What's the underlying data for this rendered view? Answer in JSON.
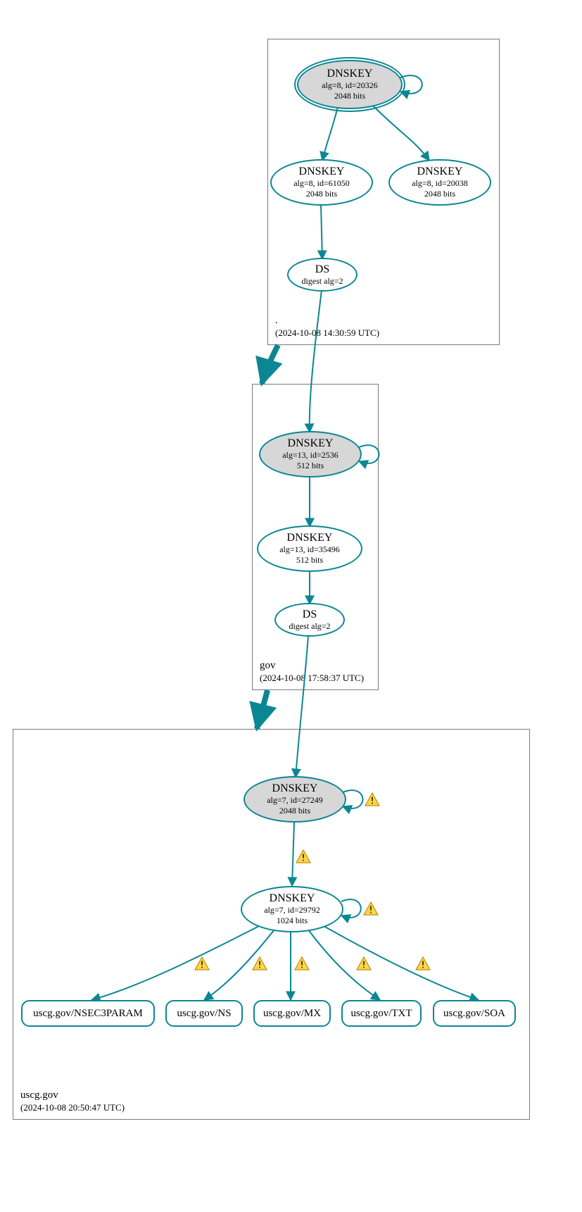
{
  "colors": {
    "teal": "#0b8793",
    "node_fill_grey": "#d7d7d7",
    "box_border": "#7a7a7a"
  },
  "zones": {
    "root": {
      "name": ".",
      "timestamp": "(2024-10-08 14:30:59 UTC)"
    },
    "gov": {
      "name": "gov",
      "timestamp": "(2024-10-08 17:58:37 UTC)"
    },
    "uscg": {
      "name": "uscg.gov",
      "timestamp": "(2024-10-08 20:50:47 UTC)"
    }
  },
  "nodes": {
    "root_ksk": {
      "title": "DNSKEY",
      "line2": "alg=8, id=20326",
      "line3": "2048 bits"
    },
    "root_zsk": {
      "title": "DNSKEY",
      "line2": "alg=8, id=61050",
      "line3": "2048 bits"
    },
    "root_dnskey3": {
      "title": "DNSKEY",
      "line2": "alg=8, id=20038",
      "line3": "2048 bits"
    },
    "root_ds": {
      "title": "DS",
      "line2": "digest alg=2"
    },
    "gov_ksk": {
      "title": "DNSKEY",
      "line2": "alg=13, id=2536",
      "line3": "512 bits"
    },
    "gov_zsk": {
      "title": "DNSKEY",
      "line2": "alg=13, id=35496",
      "line3": "512 bits"
    },
    "gov_ds": {
      "title": "DS",
      "line2": "digest alg=2"
    },
    "uscg_ksk": {
      "title": "DNSKEY",
      "line2": "alg=7, id=27249",
      "line3": "2048 bits"
    },
    "uscg_zsk": {
      "title": "DNSKEY",
      "line2": "alg=7, id=29792",
      "line3": "1024 bits"
    }
  },
  "rrsets": {
    "nsec3param": "uscg.gov/NSEC3PARAM",
    "ns": "uscg.gov/NS",
    "mx": "uscg.gov/MX",
    "txt": "uscg.gov/TXT",
    "soa": "uscg.gov/SOA"
  },
  "chart_data": {
    "type": "graph",
    "description": "DNSSEC authentication chain (DNSViz-style) for uscg.gov",
    "zones": [
      {
        "name": ".",
        "timestamp_utc": "2024-10-08 14:30:59"
      },
      {
        "name": "gov",
        "timestamp_utc": "2024-10-08 17:58:37"
      },
      {
        "name": "uscg.gov",
        "timestamp_utc": "2024-10-08 20:50:47"
      }
    ],
    "records": [
      {
        "id": "root_ksk",
        "zone": ".",
        "type": "DNSKEY",
        "alg": 8,
        "key_id": 20326,
        "bits": 2048,
        "role": "KSK/trust-anchor"
      },
      {
        "id": "root_zsk",
        "zone": ".",
        "type": "DNSKEY",
        "alg": 8,
        "key_id": 61050,
        "bits": 2048,
        "role": "ZSK"
      },
      {
        "id": "root_k3",
        "zone": ".",
        "type": "DNSKEY",
        "alg": 8,
        "key_id": 20038,
        "bits": 2048
      },
      {
        "id": "root_ds",
        "zone": ".",
        "type": "DS",
        "digest_alg": 2
      },
      {
        "id": "gov_ksk",
        "zone": "gov",
        "type": "DNSKEY",
        "alg": 13,
        "key_id": 2536,
        "bits": 512,
        "role": "KSK"
      },
      {
        "id": "gov_zsk",
        "zone": "gov",
        "type": "DNSKEY",
        "alg": 13,
        "key_id": 35496,
        "bits": 512,
        "role": "ZSK"
      },
      {
        "id": "gov_ds",
        "zone": "gov",
        "type": "DS",
        "digest_alg": 2
      },
      {
        "id": "uscg_ksk",
        "zone": "uscg.gov",
        "type": "DNSKEY",
        "alg": 7,
        "key_id": 27249,
        "bits": 2048,
        "role": "KSK",
        "status": "warning"
      },
      {
        "id": "uscg_zsk",
        "zone": "uscg.gov",
        "type": "DNSKEY",
        "alg": 7,
        "key_id": 29792,
        "bits": 1024,
        "role": "ZSK",
        "status": "warning"
      },
      {
        "id": "rr_nsec3",
        "zone": "uscg.gov",
        "type": "RRset",
        "name": "uscg.gov/NSEC3PARAM"
      },
      {
        "id": "rr_ns",
        "zone": "uscg.gov",
        "type": "RRset",
        "name": "uscg.gov/NS"
      },
      {
        "id": "rr_mx",
        "zone": "uscg.gov",
        "type": "RRset",
        "name": "uscg.gov/MX"
      },
      {
        "id": "rr_txt",
        "zone": "uscg.gov",
        "type": "RRset",
        "name": "uscg.gov/TXT"
      },
      {
        "id": "rr_soa",
        "zone": "uscg.gov",
        "type": "RRset",
        "name": "uscg.gov/SOA"
      }
    ],
    "edges": [
      {
        "from": "root_ksk",
        "to": "root_ksk",
        "kind": "self-sig"
      },
      {
        "from": "root_ksk",
        "to": "root_zsk"
      },
      {
        "from": "root_ksk",
        "to": "root_k3"
      },
      {
        "from": "root_zsk",
        "to": "root_ds"
      },
      {
        "from": "root_ds",
        "to": "gov_ksk"
      },
      {
        "from": ".",
        "to": "gov",
        "kind": "delegation"
      },
      {
        "from": "gov_ksk",
        "to": "gov_ksk",
        "kind": "self-sig"
      },
      {
        "from": "gov_ksk",
        "to": "gov_zsk"
      },
      {
        "from": "gov_zsk",
        "to": "gov_ds"
      },
      {
        "from": "gov_ds",
        "to": "uscg_ksk"
      },
      {
        "from": "gov",
        "to": "uscg.gov",
        "kind": "delegation"
      },
      {
        "from": "uscg_ksk",
        "to": "uscg_ksk",
        "kind": "self-sig",
        "status": "warning"
      },
      {
        "from": "uscg_ksk",
        "to": "uscg_zsk",
        "status": "warning"
      },
      {
        "from": "uscg_zsk",
        "to": "uscg_zsk",
        "kind": "self-sig",
        "status": "warning"
      },
      {
        "from": "uscg_zsk",
        "to": "rr_nsec3",
        "status": "warning"
      },
      {
        "from": "uscg_zsk",
        "to": "rr_ns",
        "status": "warning"
      },
      {
        "from": "uscg_zsk",
        "to": "rr_mx",
        "status": "warning"
      },
      {
        "from": "uscg_zsk",
        "to": "rr_txt",
        "status": "warning"
      },
      {
        "from": "uscg_zsk",
        "to": "rr_soa",
        "status": "warning"
      }
    ]
  }
}
